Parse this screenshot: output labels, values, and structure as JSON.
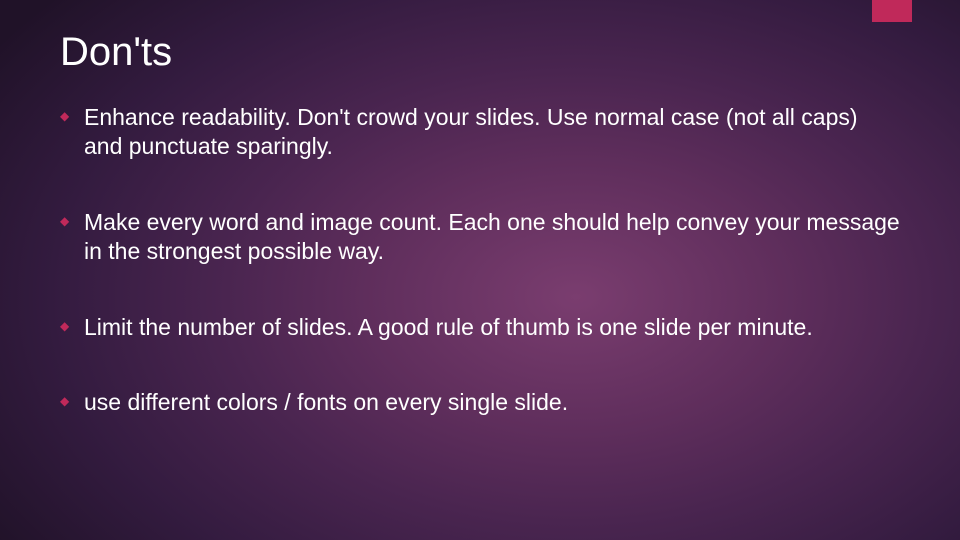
{
  "slide": {
    "title": "Don'ts",
    "bullets": [
      "Enhance readability. Don't crowd your slides. Use normal case (not all caps) and punctuate sparingly.",
      "Make every word and image count. Each one should help convey your message in the strongest possible way.",
      "Limit the number of slides. A good rule of thumb is one slide per minute.",
      "use different colors / fonts on every single slide."
    ]
  },
  "colors": {
    "accent": "#c0295a"
  }
}
